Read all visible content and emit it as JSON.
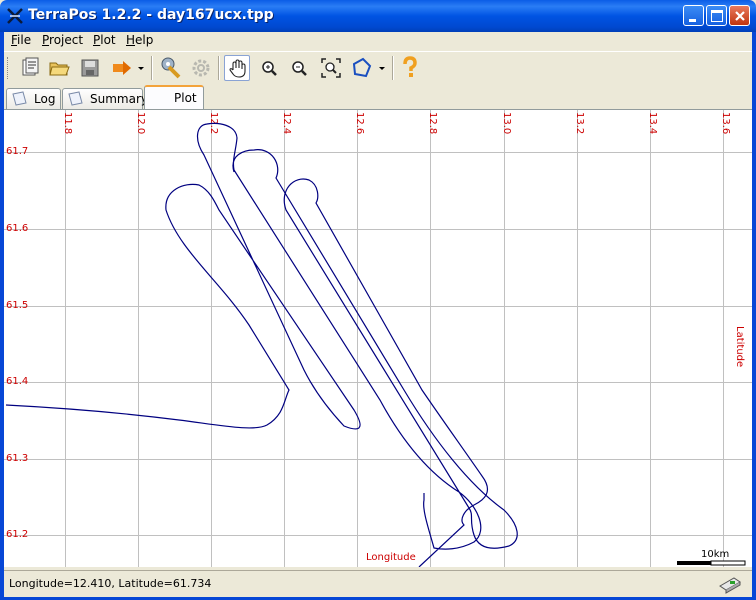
{
  "window": {
    "title": "TerraPos 1.2.2 - day167ucx.tpp",
    "controls": [
      "minimize",
      "maximize",
      "close"
    ]
  },
  "menu": {
    "file": {
      "mnemonic": "F",
      "rest": "ile"
    },
    "project": {
      "mnemonic": "P",
      "rest": "roject"
    },
    "plot": {
      "mnemonic": "P",
      "rest": "lot"
    },
    "help": {
      "mnemonic": "H",
      "rest": "elp"
    }
  },
  "toolbar": {
    "buttons": [
      "new-project-icon",
      "open-folder-icon",
      "save-icon",
      "export-icon",
      "settings-wrench-icon",
      "process-gear-icon",
      "pan-hand-icon",
      "zoom-in-icon",
      "zoom-out-icon",
      "zoom-extent-icon",
      "polygon-select-icon",
      "help-icon"
    ],
    "active": "pan-hand-icon"
  },
  "tabs": [
    {
      "label": "Log",
      "active": false
    },
    {
      "label": "Summary",
      "active": false
    },
    {
      "label": "Plot",
      "active": true
    }
  ],
  "plot": {
    "longitude_ticks": [
      "11.8",
      "12.0",
      "12.2",
      "12.4",
      "12.6",
      "12.8",
      "13.0",
      "13.2",
      "13.4",
      "13.6"
    ],
    "latitude_ticks": [
      "61.7",
      "61.6",
      "61.5",
      "61.4",
      "61.3",
      "61.2"
    ],
    "x_label": "Longitude",
    "y_label": "Latitude",
    "scale_label": "10km",
    "axis_color": "#cc0000",
    "track_color": "#000080",
    "grid_color": "#c0c0c0"
  },
  "status": {
    "text": "Longitude=12.410, Latitude=61.734",
    "icon": "receiver-status-icon"
  }
}
